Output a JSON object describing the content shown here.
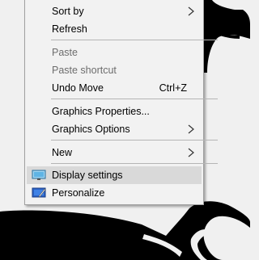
{
  "menu": {
    "items": [
      {
        "label": "Sort by",
        "shortcut": "",
        "submenu": true,
        "disabled": false
      },
      {
        "label": "Refresh",
        "shortcut": "",
        "submenu": false,
        "disabled": false
      },
      {
        "label": "Paste",
        "shortcut": "",
        "submenu": false,
        "disabled": true
      },
      {
        "label": "Paste shortcut",
        "shortcut": "",
        "submenu": false,
        "disabled": true
      },
      {
        "label": "Undo Move",
        "shortcut": "Ctrl+Z",
        "submenu": false,
        "disabled": false
      },
      {
        "label": "Graphics Properties...",
        "shortcut": "",
        "submenu": false,
        "disabled": false
      },
      {
        "label": "Graphics Options",
        "shortcut": "",
        "submenu": true,
        "disabled": false
      },
      {
        "label": "New",
        "shortcut": "",
        "submenu": true,
        "disabled": false
      },
      {
        "label": "Display settings",
        "shortcut": "",
        "submenu": false,
        "disabled": false,
        "icon": "display-settings-icon",
        "highlighted": true
      },
      {
        "label": "Personalize",
        "shortcut": "",
        "submenu": false,
        "disabled": false,
        "icon": "personalize-icon"
      }
    ]
  },
  "colors": {
    "menu_background": "#f2f2f2",
    "highlight": "#d9d9d9",
    "disabled_text": "#6d6d6d",
    "desktop_background": "#f0f0f0",
    "wallpaper_shape": "#000000"
  }
}
